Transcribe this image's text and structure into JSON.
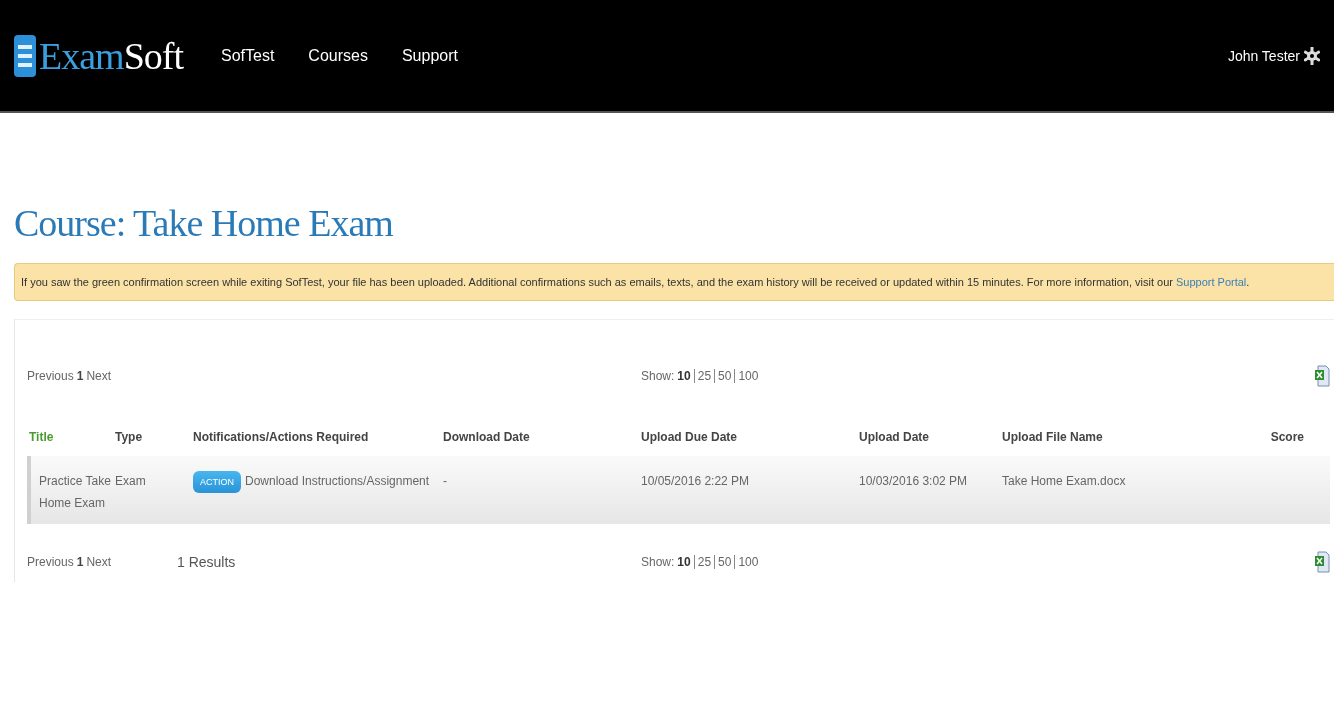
{
  "nav": {
    "logo": [
      "Exam",
      "Soft"
    ],
    "links": [
      "SofTest",
      "Courses",
      "Support"
    ],
    "user": "John Tester"
  },
  "page_title": "Course: Take Home Exam",
  "banner": {
    "text": "If you saw the green confirmation screen while exiting SofTest, your file has been uploaded. Additional confirmations such as emails, texts, and the exam history will be received or updated within 15 minutes. For more information, visit our",
    "link": "Support Portal",
    "end": "."
  },
  "pager_top": {
    "previous": "Previous",
    "page": "1",
    "next": "Next",
    "show_label": "Show:",
    "sizes": [
      {
        "label": "10",
        "selected": true
      },
      {
        "label": "25",
        "selected": false
      },
      {
        "label": "50",
        "selected": false
      },
      {
        "label": "100",
        "selected": false
      }
    ]
  },
  "table": {
    "columns": [
      {
        "label": "Title",
        "sorted": true
      },
      {
        "label": "Type",
        "sorted": false
      },
      {
        "label": "Notifications/Actions Required",
        "sorted": false
      },
      {
        "label": "Download Date",
        "sorted": false
      },
      {
        "label": "Upload Due Date",
        "sorted": false
      },
      {
        "label": "Upload Date",
        "sorted": false
      },
      {
        "label": "Upload File Name",
        "sorted": false
      },
      {
        "label": "Score",
        "sorted": false
      }
    ],
    "rows": [
      {
        "title": "Practice Take Home Exam",
        "type": "Exam",
        "action_button": "ACTION",
        "action_text": "Download Instructions/Assignment",
        "download_date": "-",
        "upload_due_date": "10/05/2016 2:22 PM",
        "upload_date": "10/03/2016 3:02 PM",
        "upload_file_name": "Take Home Exam.docx"
      }
    ]
  },
  "pager_bottom": {
    "previous": "Previous",
    "page": "1",
    "next": "Next",
    "results": "1 Results",
    "show_label": "Show:",
    "sizes": [
      {
        "label": "10",
        "selected": true
      },
      {
        "label": "25",
        "selected": false
      },
      {
        "label": "50",
        "selected": false
      },
      {
        "label": "100",
        "selected": false
      }
    ]
  }
}
